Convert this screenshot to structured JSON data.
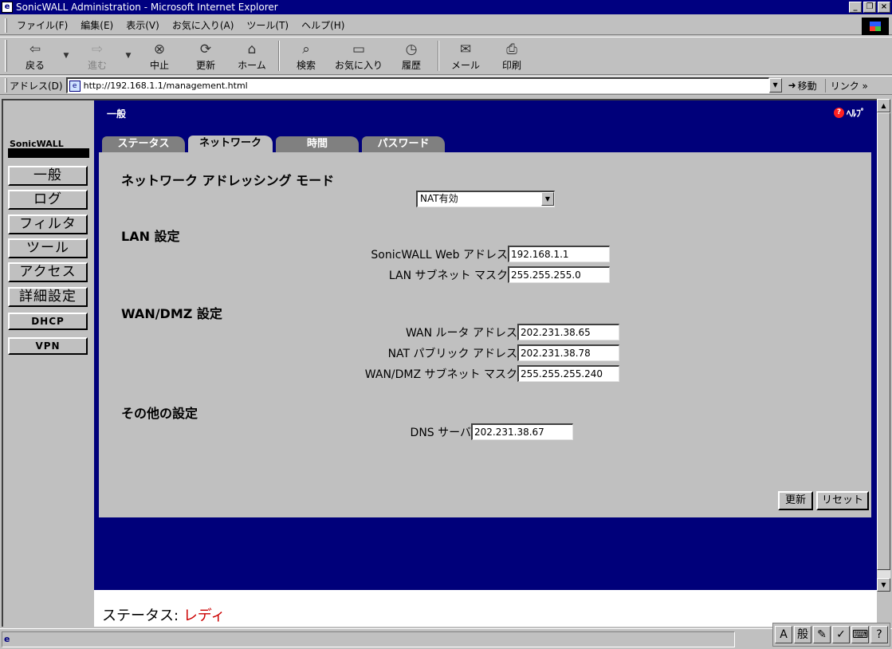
{
  "window": {
    "title": "SonicWALL Administration - Microsoft Internet Explorer",
    "buttons": [
      "_",
      "❐",
      "×"
    ]
  },
  "menu": [
    "ファイル(F)",
    "編集(E)",
    "表示(V)",
    "お気に入り(A)",
    "ツール(T)",
    "ヘルプ(H)"
  ],
  "toolbar": {
    "back": "戻る",
    "forward": "進む",
    "stop": "中止",
    "refresh": "更新",
    "home": "ホーム",
    "search": "検索",
    "favorites": "お気に入り",
    "history": "履歴",
    "mail": "メール",
    "print": "印刷"
  },
  "address": {
    "label": "アドレス(D)",
    "url": "http://192.168.1.1/management.html",
    "go": "移動",
    "links": "リンク »"
  },
  "page": {
    "section": "一般",
    "help": "ﾍﾙﾌﾟ",
    "brand": "SonicWALL",
    "nav": [
      "一般",
      "ログ",
      "フィルタ",
      "ツール",
      "アクセス",
      "詳細設定",
      "DHCP",
      "VPN"
    ],
    "tabs": [
      "ステータス",
      "ネットワーク",
      "時間",
      "パスワード"
    ],
    "active_tab": "ネットワーク",
    "addressing_mode": {
      "heading": "ネットワーク アドレッシング モード",
      "selected": "NAT有効"
    },
    "lan": {
      "heading": "LAN 設定",
      "ip_label": "SonicWALL Web アドレス",
      "ip_value": "192.168.1.1",
      "mask_label": "LAN サブネット マスク",
      "mask_value": "255.255.255.0"
    },
    "wan": {
      "heading": "WAN/DMZ 設定",
      "router_label": "WAN ルータ アドレス",
      "router_value": "202.231.38.65",
      "nat_label": "NAT パブリック アドレス",
      "nat_value": "202.231.38.78",
      "mask_label": "WAN/DMZ サブネット マスク",
      "mask_value": "255.255.255.240"
    },
    "other": {
      "heading": "その他の設定",
      "dns_label": "DNS サーバ",
      "dns_value": "202.231.38.67"
    },
    "update_button": "更新",
    "reset_button": "リセット",
    "status_label": "ステータス:",
    "status_value": "レディ"
  },
  "ime": {
    "mode": "A",
    "conversion": "般"
  },
  "colors": {
    "title_bar": "#000080",
    "content_blue": "#00007a",
    "panel_gray": "#c0c0c0",
    "status_value": "#cc0000"
  }
}
